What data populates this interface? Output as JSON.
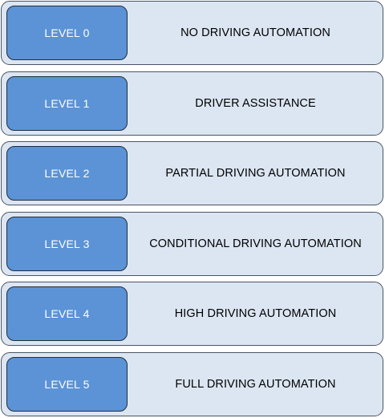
{
  "levels": [
    {
      "label": "LEVEL 0",
      "description": "NO DRIVING AUTOMATION"
    },
    {
      "label": "LEVEL 1",
      "description": "DRIVER ASSISTANCE"
    },
    {
      "label": "LEVEL 2",
      "description": "PARTIAL DRIVING AUTOMATION"
    },
    {
      "label": "LEVEL 3",
      "description": "CONDITIONAL DRIVING AUTOMATION"
    },
    {
      "label": "LEVEL 4",
      "description": "HIGH DRIVING AUTOMATION"
    },
    {
      "label": "LEVEL 5",
      "description": "FULL DRIVING AUTOMATION"
    }
  ],
  "colors": {
    "row_fill": "#dce6f2",
    "level_box_fill": "#5b93d6",
    "outline": "#1f2d3d"
  }
}
